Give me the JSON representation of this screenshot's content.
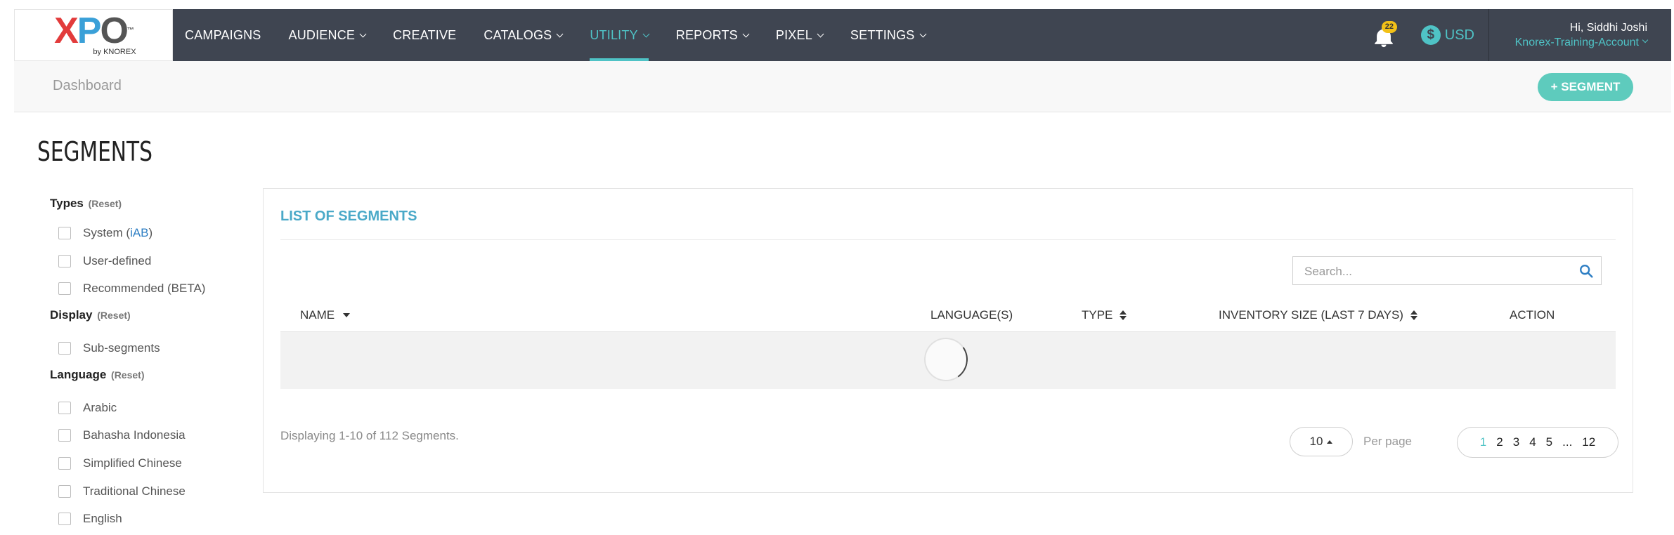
{
  "brand": {
    "logo_text": "XPO",
    "logo_sub": "by KNOREX"
  },
  "nav": {
    "items": [
      {
        "label": "CAMPAIGNS",
        "dropdown": false,
        "active": false
      },
      {
        "label": "AUDIENCE",
        "dropdown": true,
        "active": false
      },
      {
        "label": "CREATIVE",
        "dropdown": false,
        "active": false
      },
      {
        "label": "CATALOGS",
        "dropdown": true,
        "active": false
      },
      {
        "label": "UTILITY",
        "dropdown": true,
        "active": true
      },
      {
        "label": "REPORTS",
        "dropdown": true,
        "active": false
      },
      {
        "label": "PIXEL",
        "dropdown": true,
        "active": false
      },
      {
        "label": "SETTINGS",
        "dropdown": true,
        "active": false
      }
    ]
  },
  "header": {
    "notifications_count": "22",
    "currency_symbol": "$",
    "currency": "USD",
    "greeting": "Hi, Siddhi Joshi",
    "account": "Knorex-Training-Account"
  },
  "subbar": {
    "breadcrumb": "Dashboard",
    "add_button": "+ SEGMENT"
  },
  "page": {
    "title": "SEGMENTS"
  },
  "filters": {
    "types": {
      "title": "Types",
      "reset": "(Reset)",
      "options": [
        "System (",
        "User-defined",
        "Recommended (BETA)"
      ],
      "iab": "iAB",
      "iab_close": ")"
    },
    "display": {
      "title": "Display",
      "reset": "(Reset)",
      "options": [
        "Sub-segments"
      ]
    },
    "language": {
      "title": "Language",
      "reset": "(Reset)",
      "options": [
        "Arabic",
        "Bahasha Indonesia",
        "Simplified Chinese",
        "Traditional Chinese",
        "English"
      ]
    }
  },
  "list": {
    "title": "LIST OF SEGMENTS",
    "search_placeholder": "Search...",
    "columns": [
      "NAME",
      "LANGUAGE(S)",
      "TYPE",
      "INVENTORY SIZE (LAST 7 DAYS)",
      "ACTION"
    ],
    "status": "Displaying 1-10 of 112 Segments.",
    "per_page_value": "10",
    "per_page_label": "Per page",
    "pages": [
      "1",
      "2",
      "3",
      "4",
      "5",
      "...",
      "12"
    ],
    "current_page": "1"
  },
  "colors": {
    "topbar": "#3f4551",
    "accent": "#4fc3c6",
    "button": "#5ecbbd",
    "title_blue": "#4aa9c8",
    "badge": "#f2c118"
  }
}
